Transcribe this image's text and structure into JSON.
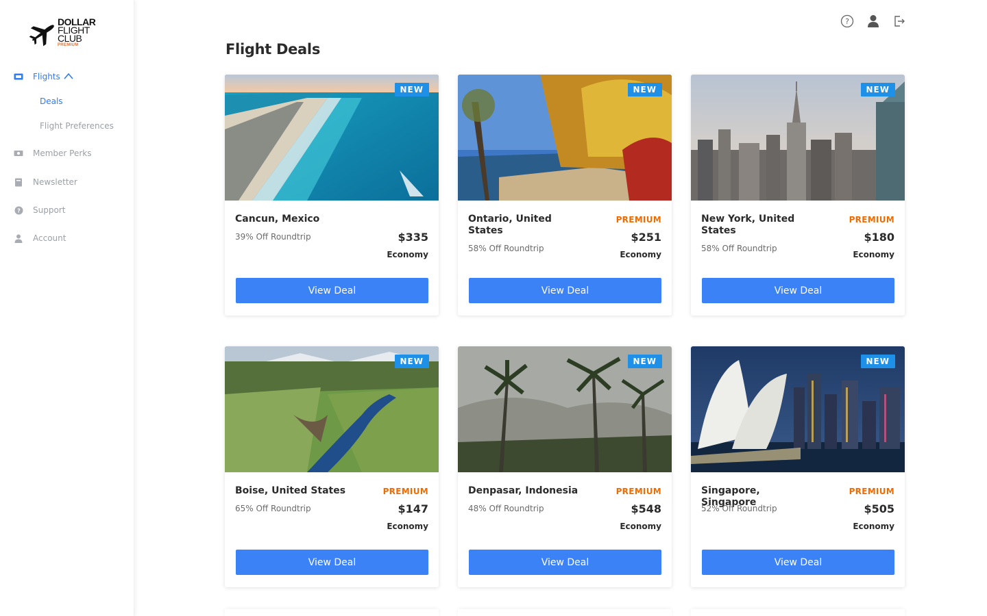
{
  "brand": {
    "line1": "DOLLAR",
    "line2": "FLIGHT",
    "line3": "CLUB",
    "line4": "PREMIUM",
    "accent_color": "#f26a21"
  },
  "sidebar": {
    "items": [
      {
        "label": "Flights",
        "icon": "ticket-icon",
        "active": true,
        "expanded": true
      },
      {
        "label": "Member Perks",
        "icon": "cash-icon"
      },
      {
        "label": "Newsletter",
        "icon": "book-icon"
      },
      {
        "label": "Support",
        "icon": "question-icon"
      },
      {
        "label": "Account",
        "icon": "person-icon"
      }
    ],
    "subitems": [
      {
        "label": "Deals",
        "active": true
      },
      {
        "label": "Flight Preferences"
      }
    ]
  },
  "header": {
    "icons": [
      "help-icon",
      "user-icon",
      "logout-icon"
    ]
  },
  "page": {
    "title": "Flight Deals"
  },
  "colors": {
    "primary": "#3b82f6",
    "badge": "#1e90e8",
    "premium": "#ef6c00"
  },
  "deals": [
    {
      "city": "Cancun, Mexico",
      "discount": "39% Off Roundtrip",
      "tier": "",
      "price": "$335",
      "cabin": "Economy",
      "badge": "NEW",
      "button": "View Deal"
    },
    {
      "city": "Ontario, United States",
      "discount": "58% Off Roundtrip",
      "tier": "PREMIUM",
      "price": "$251",
      "cabin": "Economy",
      "badge": "NEW",
      "button": "View Deal"
    },
    {
      "city": "New York, United States",
      "discount": "58% Off Roundtrip",
      "tier": "PREMIUM",
      "price": "$180",
      "cabin": "Economy",
      "badge": "NEW",
      "button": "View Deal"
    },
    {
      "city": "Boise, United States",
      "discount": "65% Off Roundtrip",
      "tier": "PREMIUM",
      "price": "$147",
      "cabin": "Economy",
      "badge": "NEW",
      "button": "View Deal"
    },
    {
      "city": "Denpasar, Indonesia",
      "discount": "48% Off Roundtrip",
      "tier": "PREMIUM",
      "price": "$548",
      "cabin": "Economy",
      "badge": "NEW",
      "button": "View Deal"
    },
    {
      "city": "Singapore, Singapore",
      "discount": "52% Off Roundtrip",
      "tier": "PREMIUM",
      "price": "$505",
      "cabin": "Economy",
      "badge": "NEW",
      "button": "View Deal"
    }
  ]
}
